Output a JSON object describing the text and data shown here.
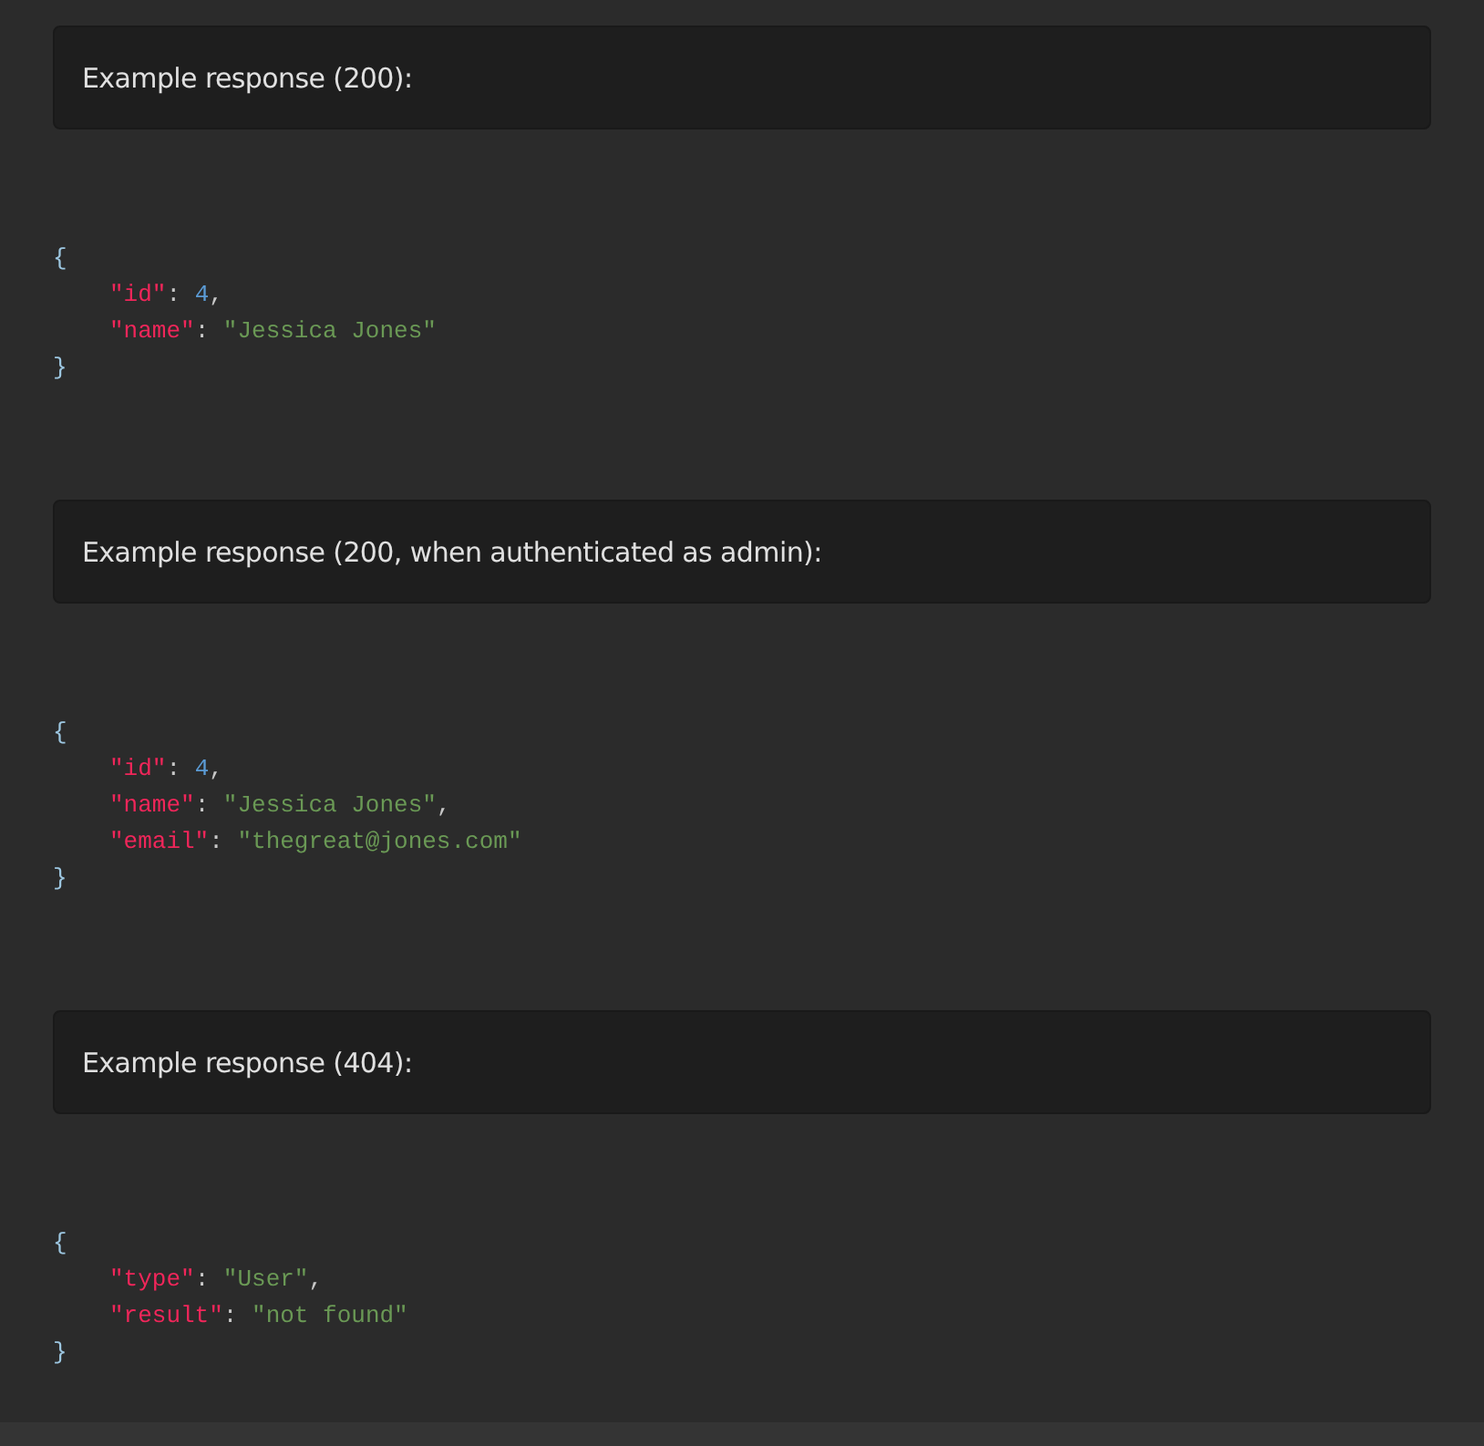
{
  "sections": [
    {
      "heading": "Example response (200):",
      "code": [
        [
          {
            "kind": "brace",
            "text": "{"
          }
        ],
        [
          {
            "kind": "key",
            "text": "\"id\""
          },
          {
            "kind": "punct",
            "text": ": "
          },
          {
            "kind": "number",
            "text": "4"
          },
          {
            "kind": "punct",
            "text": ","
          }
        ],
        [
          {
            "kind": "key",
            "text": "\"name\""
          },
          {
            "kind": "punct",
            "text": ": "
          },
          {
            "kind": "string",
            "text": "\"Jessica Jones\""
          }
        ],
        [
          {
            "kind": "brace",
            "text": "}"
          }
        ]
      ]
    },
    {
      "heading": "Example response (200, when authenticated as admin):",
      "code": [
        [
          {
            "kind": "brace",
            "text": "{"
          }
        ],
        [
          {
            "kind": "key",
            "text": "\"id\""
          },
          {
            "kind": "punct",
            "text": ": "
          },
          {
            "kind": "number",
            "text": "4"
          },
          {
            "kind": "punct",
            "text": ","
          }
        ],
        [
          {
            "kind": "key",
            "text": "\"name\""
          },
          {
            "kind": "punct",
            "text": ": "
          },
          {
            "kind": "string",
            "text": "\"Jessica Jones\""
          },
          {
            "kind": "punct",
            "text": ","
          }
        ],
        [
          {
            "kind": "key",
            "text": "\"email\""
          },
          {
            "kind": "punct",
            "text": ": "
          },
          {
            "kind": "string",
            "text": "\"thegreat@jones.com\""
          }
        ],
        [
          {
            "kind": "brace",
            "text": "}"
          }
        ]
      ]
    },
    {
      "heading": "Example response (404):",
      "code": [
        [
          {
            "kind": "brace",
            "text": "{"
          }
        ],
        [
          {
            "kind": "key",
            "text": "\"type\""
          },
          {
            "kind": "punct",
            "text": ": "
          },
          {
            "kind": "string",
            "text": "\"User\""
          },
          {
            "kind": "punct",
            "text": ","
          }
        ],
        [
          {
            "kind": "key",
            "text": "\"result\""
          },
          {
            "kind": "punct",
            "text": ": "
          },
          {
            "kind": "string",
            "text": "\"not found\""
          }
        ],
        [
          {
            "kind": "brace",
            "text": "}"
          }
        ]
      ]
    }
  ]
}
